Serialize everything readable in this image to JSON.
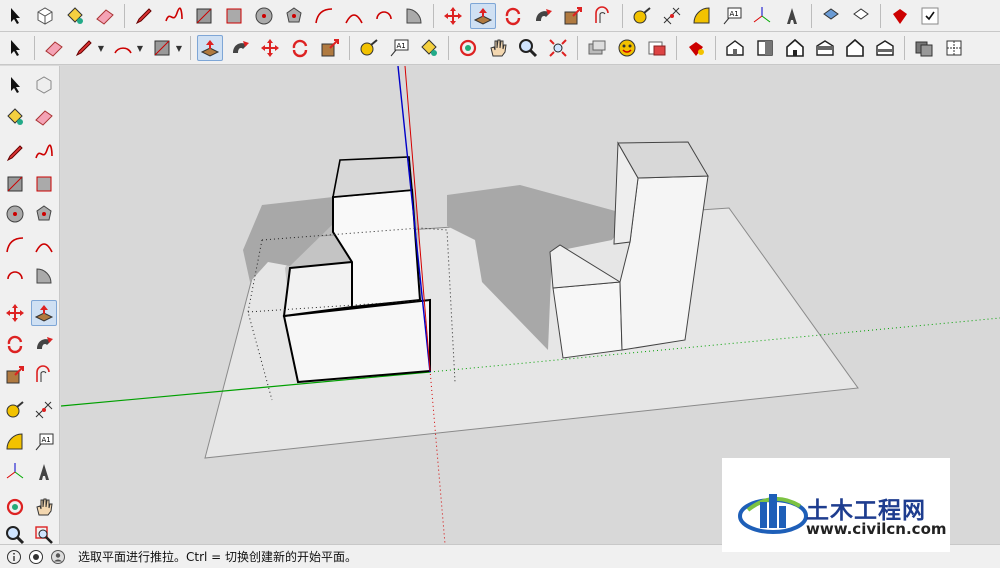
{
  "toolbar_top": {
    "icons": [
      "select-icon",
      "component-icon",
      "paint-bucket-icon",
      "eraser-icon",
      "pencil-icon",
      "freehand-icon",
      "rectangle-icon",
      "rotated-rectangle-icon",
      "circle-icon",
      "polygon-icon",
      "arc-icon",
      "two-point-arc-icon",
      "three-point-arc-icon",
      "pie-icon",
      "move-icon",
      "push-pull-icon",
      "rotate-icon",
      "follow-me-icon",
      "scale-icon",
      "offset-icon",
      "tape-measure-icon",
      "dimension-icon",
      "protractor-icon",
      "text-icon",
      "axes-icon",
      "3d-text-icon",
      "section-plane-icon",
      "display-section-icon",
      "ruby-icon",
      "check-icon"
    ],
    "text_icon_label": "A1"
  },
  "toolbar_second": {
    "icons": [
      "select-icon",
      "eraser-icon",
      "pencil-icon",
      "arc-icon",
      "rectangle-icon",
      "push-pull-icon",
      "follow-me-icon",
      "move-icon",
      "rotate-icon",
      "scale-icon",
      "tape-measure-icon",
      "text-icon",
      "paint-bucket-icon",
      "orbit-icon",
      "pan-icon",
      "zoom-icon",
      "zoom-extents-icon",
      "warehouse-icon",
      "extension-icon",
      "add-location-icon",
      "ruby-console-icon",
      "iso-view-icon",
      "top-view-icon",
      "front-view-icon",
      "right-view-icon",
      "back-view-icon",
      "left-view-icon",
      "x-ray-icon",
      "back-edges-icon"
    ],
    "text_icon_label": "A1"
  },
  "left_toolbar": {
    "icons": [
      "select-icon",
      "component-icon",
      "paint-bucket-icon",
      "eraser-icon",
      "pencil-icon",
      "freehand-icon",
      "rectangle-icon",
      "rotated-rectangle-icon",
      "circle-icon",
      "polygon-icon",
      "arc-icon",
      "pie-icon",
      "two-point-arc-icon",
      "three-point-arc-icon",
      "move-icon",
      "push-pull-icon",
      "rotate-icon",
      "follow-me-icon",
      "scale-icon",
      "offset-icon",
      "tape-measure-icon",
      "dimension-icon",
      "protractor-icon",
      "text-icon",
      "axes-icon",
      "3d-text-icon",
      "orbit-icon",
      "pan-icon",
      "zoom-icon",
      "zoom-window-icon"
    ],
    "text_icon_label": "A1"
  },
  "statusbar": {
    "text": "选取平面进行推拉。Ctrl = 切换创建新的开始平面。",
    "icons": [
      "info-icon",
      "credits-icon",
      "user-icon"
    ]
  },
  "watermark": {
    "title": "土木工程网",
    "url": "www.civilcn.com"
  },
  "colors": {
    "red_axis": "#d40000",
    "green_axis": "#00a000",
    "blue_axis": "#0000c8",
    "shadow": "#a8a8a8",
    "ground": "#e6e6e6"
  }
}
